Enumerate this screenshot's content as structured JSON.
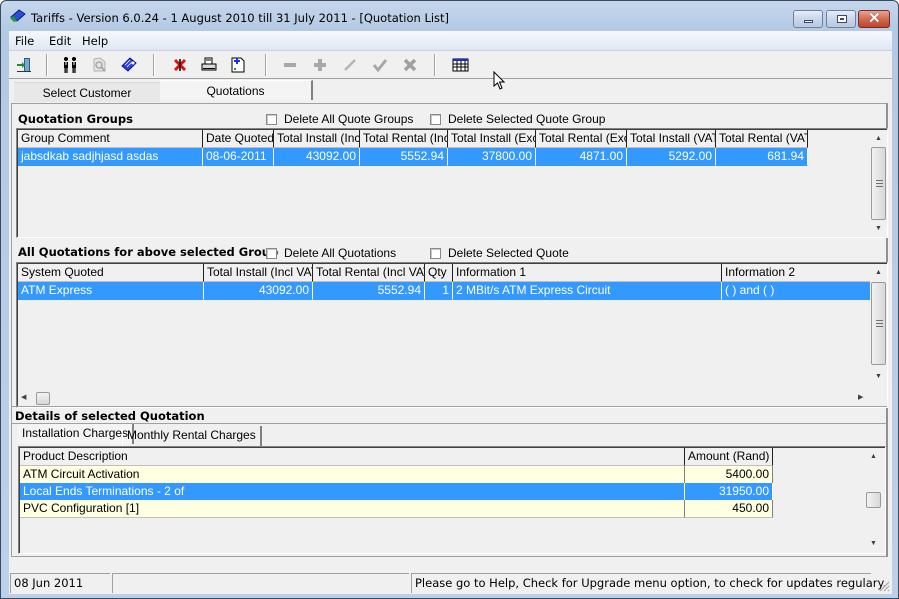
{
  "window": {
    "title": "Tariffs - Version 6.0.24 - 1 August 2010 till 31 July 2011 - [Quotation List]",
    "controls": {
      "minimize": "minimize",
      "maximize": "maximize",
      "close": "close"
    }
  },
  "menu": [
    {
      "label": "File"
    },
    {
      "label": "Edit"
    },
    {
      "label": "Help"
    }
  ],
  "toolbar": {
    "buttons": [
      {
        "icon": "exit-door-icon",
        "enabled": true
      },
      {
        "icon": "users-icon",
        "enabled": true
      },
      {
        "icon": "search-document-icon",
        "enabled": false
      },
      {
        "icon": "tag-icon",
        "enabled": true
      },
      {
        "icon": "delete-x-icon",
        "enabled": true
      },
      {
        "icon": "print-icon",
        "enabled": true
      },
      {
        "icon": "new-document-icon",
        "enabled": true
      },
      {
        "icon": "minus-icon",
        "enabled": false
      },
      {
        "icon": "plus-icon",
        "enabled": false
      },
      {
        "icon": "edit-pencil-icon",
        "enabled": false
      },
      {
        "icon": "check-icon",
        "enabled": false
      },
      {
        "icon": "cancel-x-icon",
        "enabled": false
      },
      {
        "icon": "table-icon",
        "enabled": true
      }
    ]
  },
  "top_tabs": [
    {
      "label": "Select Customer",
      "active": false
    },
    {
      "label": "Quotations",
      "active": true
    }
  ],
  "quotation_groups": {
    "title": "Quotation Groups",
    "delete_all_label": "Delete All Quote Groups",
    "delete_selected_label": "Delete Selected Quote Group",
    "columns": [
      "Group Comment",
      "Date Quoted",
      "Total Install (Incl)",
      "Total Rental (Incl)",
      "Total Install (Excl)",
      "Total Rental (Excl)",
      "Total Install (VAT)",
      "Total Rental (VAT)"
    ],
    "rows": [
      {
        "cells": [
          "jabsdkab sadjhjasd asdas",
          "08-06-2011",
          "43092.00",
          "5552.94",
          "37800.00",
          "4871.00",
          "5292.00",
          "681.94"
        ],
        "selected": true
      }
    ]
  },
  "quotations": {
    "title": "All Quotations for above selected Group",
    "delete_all_label": "Delete All Quotations",
    "delete_selected_label": "Delete Selected Quote",
    "columns": [
      "System Quoted",
      "Total Install (Incl VAT)",
      "Total Rental (Incl VAT)",
      "Qty",
      "Information 1",
      "Information 2"
    ],
    "rows": [
      {
        "cells": [
          "ATM Express",
          "43092.00",
          "5552.94",
          "1",
          "2 MBit/s ATM Express Circuit",
          "( ) and ( )"
        ],
        "selected": true
      }
    ]
  },
  "details": {
    "title": "Details of selected Quotation",
    "tabs": [
      {
        "label": "Installation Charges",
        "active": true
      },
      {
        "label": "Monthly Rental Charges",
        "active": false
      }
    ],
    "columns": [
      "Product Description",
      "Amount (Rand)"
    ],
    "rows": [
      {
        "cells": [
          "ATM Circuit Activation",
          "5400.00"
        ],
        "selected": false
      },
      {
        "cells": [
          "Local Ends Terminations - 2 of",
          "31950.00"
        ],
        "selected": true
      },
      {
        "cells": [
          "PVC Configuration [1]",
          "450.00"
        ],
        "selected": false
      }
    ]
  },
  "statusbar": {
    "date": "08 Jun 2011",
    "middle": "",
    "message": "Please go to Help, Check for Upgrade menu option, to check for updates regulary."
  },
  "colors": {
    "selection": "#3399ff",
    "row_highlight": "#ffffe1",
    "close_button": "#c1432b"
  }
}
